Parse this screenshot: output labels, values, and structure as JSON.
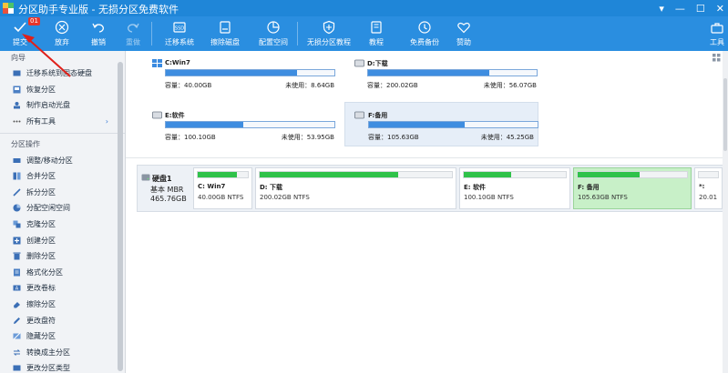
{
  "window": {
    "title": "分区助手专业版 - 无损分区免费软件",
    "controls": [
      "▾",
      "—",
      "☐",
      "✕"
    ]
  },
  "toolbar": {
    "commit": {
      "label": "提交",
      "badge": "01"
    },
    "discard": {
      "label": "放弃"
    },
    "undo": {
      "label": "撤销"
    },
    "redo": {
      "label": "重做"
    },
    "migrate": {
      "label": "迁移系统"
    },
    "wipe": {
      "label": "擦除磁盘"
    },
    "allocate": {
      "label": "配置空间"
    },
    "lossless": {
      "label": "无损分区教程"
    },
    "tutorial": {
      "label": "教程"
    },
    "backup": {
      "label": "免费备份"
    },
    "donate": {
      "label": "赞助"
    },
    "tools": {
      "label": "工具"
    }
  },
  "sidebar": {
    "wizard_header": "向导",
    "wizard_items": [
      {
        "label": "迁移系统到固态硬盘"
      },
      {
        "label": "恢复分区"
      },
      {
        "label": "制作启动光盘"
      },
      {
        "label": "所有工具"
      }
    ],
    "ops_header": "分区操作",
    "ops_items": [
      {
        "label": "调整/移动分区"
      },
      {
        "label": "合并分区"
      },
      {
        "label": "拆分分区"
      },
      {
        "label": "分配空闲空间"
      },
      {
        "label": "克隆分区"
      },
      {
        "label": "创建分区"
      },
      {
        "label": "删除分区"
      },
      {
        "label": "格式化分区"
      },
      {
        "label": "更改卷标"
      },
      {
        "label": "擦除分区"
      },
      {
        "label": "更改盘符"
      },
      {
        "label": "隐藏分区"
      },
      {
        "label": "转换成主分区"
      },
      {
        "label": "更改分区类型"
      }
    ]
  },
  "drives": [
    {
      "name": "C:Win7",
      "used_fraction": 0.78,
      "capacity": "容量：40.00GB",
      "free": "未使用：8.64GB"
    },
    {
      "name": "D:下载",
      "used_fraction": 0.72,
      "capacity": "容量：200.02GB",
      "free": "未使用：56.07GB"
    },
    {
      "name": "E:软件",
      "used_fraction": 0.46,
      "capacity": "容量：100.10GB",
      "free": "未使用：53.95GB"
    },
    {
      "name": "F:备用",
      "used_fraction": 0.57,
      "capacity": "容量：105.63GB",
      "free": "未使用：45.25GB"
    }
  ],
  "disk": {
    "name": "硬盘1",
    "type": "基本 MBR",
    "size": "465.76GB",
    "partitions": [
      {
        "name": "C: Win7",
        "info": "40.00GB NTFS",
        "used_fraction": 0.78
      },
      {
        "name": "D: 下载",
        "info": "200.02GB NTFS",
        "used_fraction": 0.72
      },
      {
        "name": "E: 软件",
        "info": "100.10GB NTFS",
        "used_fraction": 0.46
      },
      {
        "name": "F: 备用",
        "info": "105.63GB NTFS",
        "used_fraction": 0.57
      },
      {
        "name": "*:",
        "info": "20.01",
        "used_fraction": 0
      }
    ]
  },
  "colors": {
    "titlebar": "#1f86d8",
    "toolbar": "#2a8ee0",
    "usage_bar": "#3e8de0",
    "partition_bar": "#2fc24a",
    "selected_partition": "#c8f0c8",
    "arrow": "#e0201a"
  }
}
